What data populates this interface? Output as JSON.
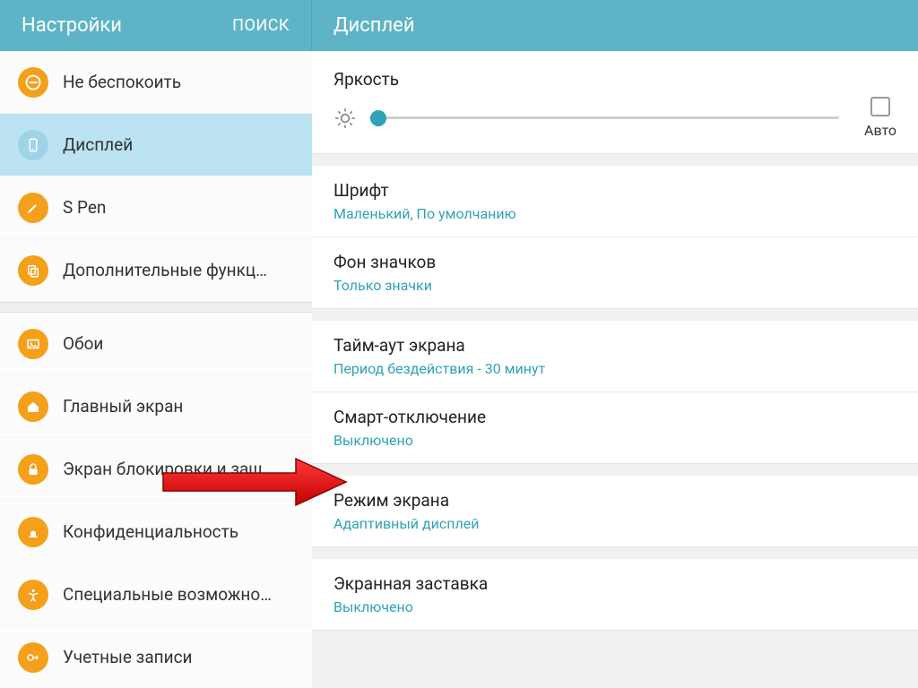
{
  "sidebar": {
    "title": "Настройки",
    "search": "ПОИСК",
    "items": [
      {
        "label": "Не беспокоить"
      },
      {
        "label": "Дисплей"
      },
      {
        "label": "S Pen"
      },
      {
        "label": "Дополнительные функц…"
      },
      {
        "label": "Обои"
      },
      {
        "label": "Главный экран"
      },
      {
        "label": "Экран блокировки и защ…"
      },
      {
        "label": "Конфиденциальность"
      },
      {
        "label": "Специальные возможно…"
      },
      {
        "label": "Учетные записи"
      }
    ]
  },
  "content": {
    "header": "Дисплей",
    "brightness": {
      "title": "Яркость",
      "auto": "Авто"
    },
    "rows": {
      "font_title": "Шрифт",
      "font_sub": "Маленький, По умолчанию",
      "iconbg_title": "Фон значков",
      "iconbg_sub": "Только значки",
      "timeout_title": "Тайм-аут экрана",
      "timeout_sub": "Период бездействия - 30 минут",
      "smart_title": "Смарт-отключение",
      "smart_sub": "Выключено",
      "mode_title": "Режим экрана",
      "mode_sub": "Адаптивный дисплей",
      "saver_title": "Экранная заставка",
      "saver_sub": "Выключено"
    }
  }
}
